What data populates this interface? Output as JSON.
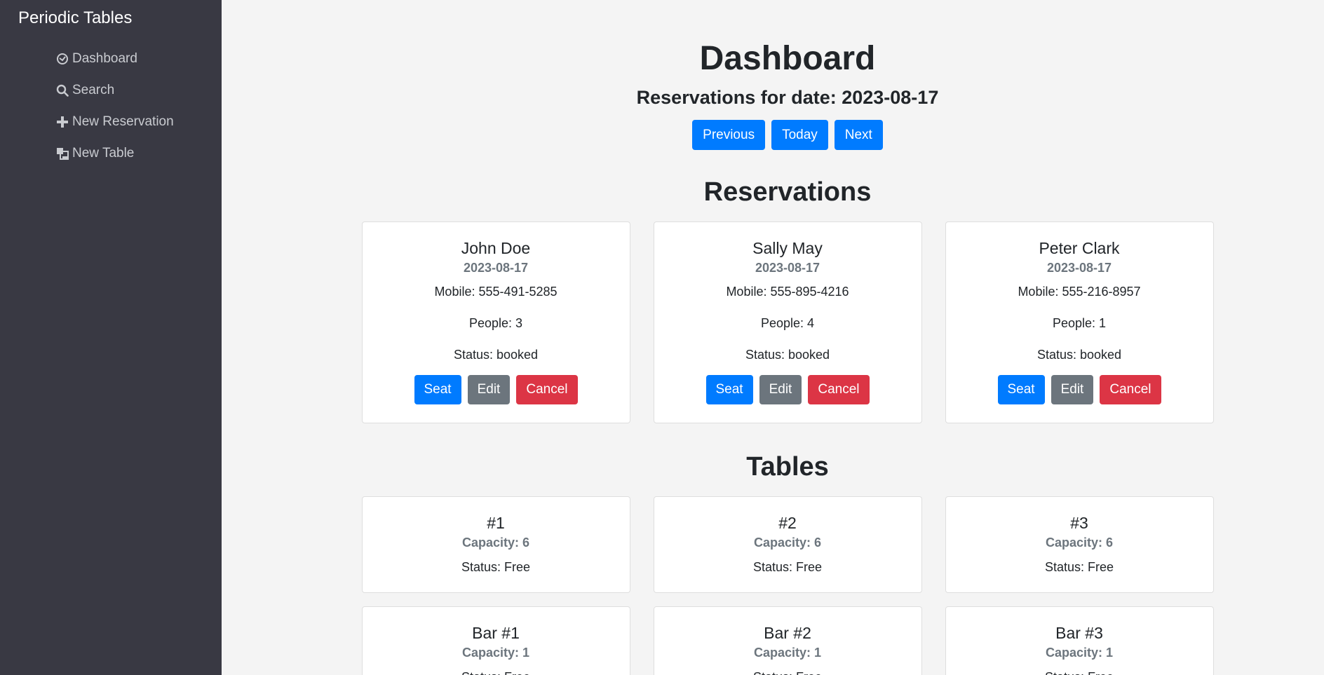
{
  "sidebar": {
    "brand": "Periodic Tables",
    "items": [
      {
        "label": "Dashboard",
        "icon": "dashboard-icon"
      },
      {
        "label": "Search",
        "icon": "search-icon"
      },
      {
        "label": "New Reservation",
        "icon": "plus-icon"
      },
      {
        "label": "New Table",
        "icon": "table-icon"
      }
    ]
  },
  "header": {
    "title": "Dashboard",
    "date_heading": "Reservations for date: 2023-08-17",
    "buttons": {
      "previous": "Previous",
      "today": "Today",
      "next": "Next"
    }
  },
  "reservations": {
    "title": "Reservations",
    "items": [
      {
        "name": "John Doe",
        "date": "2023-08-17",
        "mobile": "Mobile: 555-491-5285",
        "people": "People: 3",
        "status": "Status: booked"
      },
      {
        "name": "Sally May",
        "date": "2023-08-17",
        "mobile": "Mobile: 555-895-4216",
        "people": "People: 4",
        "status": "Status: booked"
      },
      {
        "name": "Peter Clark",
        "date": "2023-08-17",
        "mobile": "Mobile: 555-216-8957",
        "people": "People: 1",
        "status": "Status: booked"
      }
    ],
    "actions": {
      "seat": "Seat",
      "edit": "Edit",
      "cancel": "Cancel"
    }
  },
  "tables": {
    "title": "Tables",
    "items": [
      {
        "name": "#1",
        "capacity": "Capacity: 6",
        "status": "Status: Free"
      },
      {
        "name": "#2",
        "capacity": "Capacity: 6",
        "status": "Status: Free"
      },
      {
        "name": "#3",
        "capacity": "Capacity: 6",
        "status": "Status: Free"
      },
      {
        "name": "Bar #1",
        "capacity": "Capacity: 1",
        "status": "Status: Free"
      },
      {
        "name": "Bar #2",
        "capacity": "Capacity: 1",
        "status": "Status: Free"
      },
      {
        "name": "Bar #3",
        "capacity": "Capacity: 1",
        "status": "Status: Free"
      }
    ]
  },
  "colors": {
    "sidebar_bg": "#393943",
    "primary": "#007bff",
    "secondary": "#6c757d",
    "danger": "#dc3545"
  }
}
